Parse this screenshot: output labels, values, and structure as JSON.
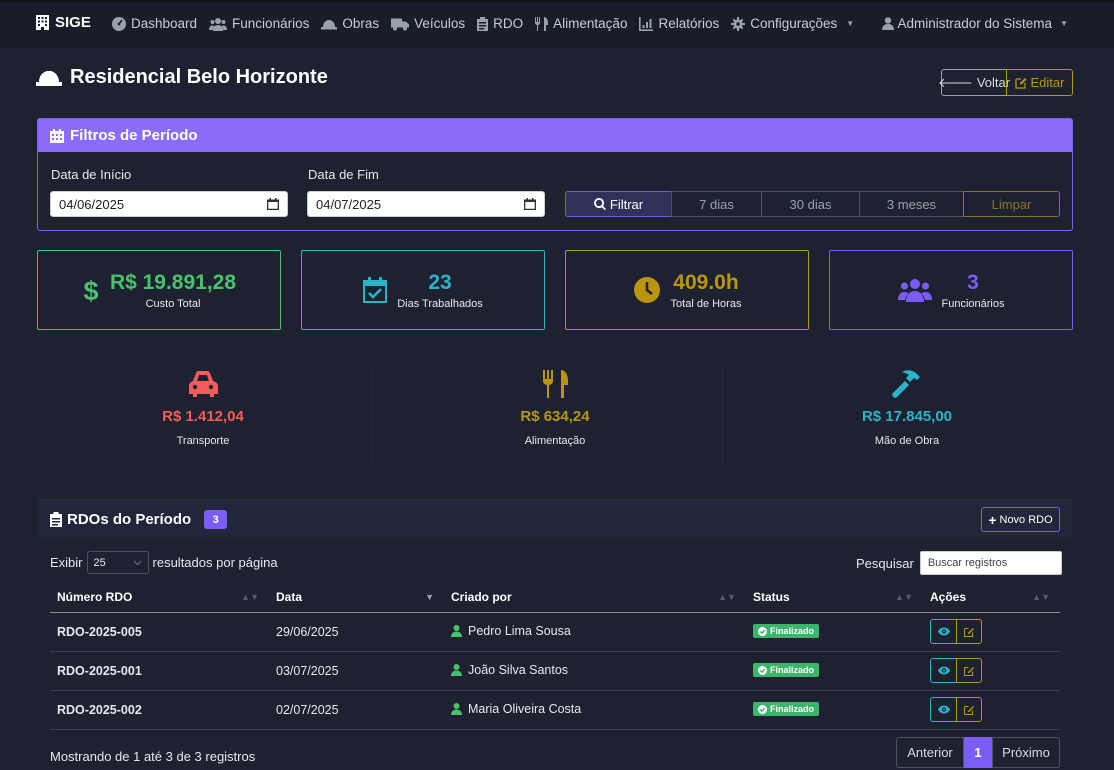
{
  "navbar": {
    "brand": "SIGE",
    "items": [
      {
        "label": "Dashboard",
        "icon": "dashboard-icon"
      },
      {
        "label": "Funcionários",
        "icon": "users-icon"
      },
      {
        "label": "Obras",
        "icon": "hard-hat-icon"
      },
      {
        "label": "Veículos",
        "icon": "truck-icon"
      },
      {
        "label": "RDO",
        "icon": "clipboard-icon"
      },
      {
        "label": "Alimentação",
        "icon": "utensils-icon"
      },
      {
        "label": "Relatórios",
        "icon": "chart-icon"
      },
      {
        "label": "Configurações",
        "icon": "gear-icon"
      }
    ],
    "user": "Administrador do Sistema"
  },
  "header": {
    "title": "Residencial Belo Horizonte",
    "back_label": "Voltar",
    "edit_label": "Editar"
  },
  "filters": {
    "title": "Filtros de Período",
    "start_label": "Data de Início",
    "start_value": "04/06/2025",
    "end_label": "Data de Fim",
    "end_value": "04/07/2025",
    "filter_label": "Filtrar",
    "range_7": "7 dias",
    "range_30": "30 dias",
    "range_3m": "3 meses",
    "clear_label": "Limpar"
  },
  "stats": {
    "cost": {
      "value": "R$ 19.891,28",
      "label": "Custo Total",
      "color": "#49c26e"
    },
    "days": {
      "value": "23",
      "label": "Dias Trabalhados",
      "color": "#2ab3c9"
    },
    "hours": {
      "value": "409.0h",
      "label": "Total de Horas",
      "color": "#b8960f"
    },
    "employees": {
      "value": "3",
      "label": "Funcionários",
      "color": "#7c5cf7"
    }
  },
  "costs": {
    "transport": {
      "value": "R$ 1.412,04",
      "label": "Transporte",
      "color": "#f25c5c"
    },
    "food": {
      "value": "R$ 634,24",
      "label": "Alimentação",
      "color": "#b8960f"
    },
    "labor": {
      "value": "R$ 17.845,00",
      "label": "Mão de Obra",
      "color": "#2ab3c9"
    }
  },
  "rdo": {
    "title": "RDOs do Período",
    "count": "3",
    "new_label": "Novo RDO",
    "show_label": "Exibir",
    "page_size": "25",
    "per_page_label": "resultados por página",
    "search_label": "Pesquisar",
    "search_placeholder": "Buscar registros",
    "columns": [
      "Número RDO",
      "Data",
      "Criado por",
      "Status",
      "Ações"
    ],
    "rows": [
      {
        "numero": "RDO-2025-005",
        "data": "29/06/2025",
        "criado_por": "Pedro Lima Sousa",
        "status": "Finalizado"
      },
      {
        "numero": "RDO-2025-001",
        "data": "03/07/2025",
        "criado_por": "João Silva Santos",
        "status": "Finalizado"
      },
      {
        "numero": "RDO-2025-002",
        "data": "02/07/2025",
        "criado_por": "Maria Oliveira Costa",
        "status": "Finalizado"
      }
    ],
    "showing": "Mostrando de 1 até 3 de 3 registros",
    "prev_label": "Anterior",
    "current_page": "1",
    "next_label": "Próximo"
  }
}
